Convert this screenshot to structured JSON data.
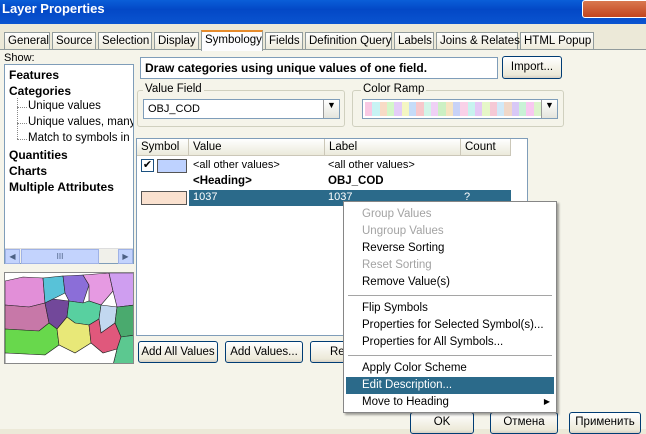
{
  "window": {
    "title": "Layer Properties"
  },
  "tabs": [
    "General",
    "Source",
    "Selection",
    "Display",
    "Symbology",
    "Fields",
    "Definition Query",
    "Labels",
    "Joins & Relates",
    "HTML Popup"
  ],
  "active_tab": "Symbology",
  "show_panel": {
    "label": "Show:",
    "items": [
      {
        "label": "Features",
        "level": 0
      },
      {
        "label": "Categories",
        "level": 0
      },
      {
        "label": "Unique values",
        "level": 1
      },
      {
        "label": "Unique values, many fields",
        "level": 1
      },
      {
        "label": "Match to symbols in a style",
        "level": 1
      },
      {
        "label": "Quantities",
        "level": 0
      },
      {
        "label": "Charts",
        "level": 0
      },
      {
        "label": "Multiple Attributes",
        "level": 0
      }
    ],
    "scroll_grip": "III"
  },
  "description": "Draw categories using unique values of one field.",
  "import_label": "Import...",
  "value_field": {
    "label": "Value Field",
    "value": "OBJ_COD"
  },
  "color_ramp": {
    "label": "Color Ramp",
    "colors": [
      "#f9c9e3",
      "#c7f3f4",
      "#f8dbc6",
      "#d4f7c9",
      "#e4cdf8",
      "#f4f6c3",
      "#c5dcf8",
      "#f7c8cb",
      "#d2f5e8",
      "#efd0f5",
      "#ccf0c4",
      "#f6e4c2",
      "#c8d2f7",
      "#f9d1e8",
      "#c8f3ef",
      "#e5c9f5",
      "#e6f7c8",
      "#f5c9d6",
      "#d1e9f8",
      "#f0d8c9",
      "#d8c8f6",
      "#c9f2d6",
      "#f8c8f0",
      "#dcf4cb"
    ]
  },
  "table": {
    "columns": [
      "Symbol",
      "Value",
      "Label",
      "Count"
    ],
    "rows": [
      {
        "checked": true,
        "symbol_color": "#bed2ff",
        "value": "<all other values>",
        "label": "<all other values>",
        "count": "",
        "bold": false
      },
      {
        "checked": false,
        "symbol_color": "",
        "value": "<Heading>",
        "label": "OBJ_COD",
        "count": "",
        "bold": true
      },
      {
        "checked": false,
        "symbol_color": "#fae1cf",
        "value": "1037",
        "label": "1037",
        "count": "?",
        "bold": false,
        "selected": true
      }
    ]
  },
  "buttons": {
    "add_all": "Add All Values",
    "add_values": "Add Values...",
    "remove_partial": "Re"
  },
  "context_menu": [
    {
      "label": "Group Values",
      "enabled": false
    },
    {
      "label": "Ungroup Values",
      "enabled": false
    },
    {
      "label": "Reverse Sorting",
      "enabled": true
    },
    {
      "label": "Reset Sorting",
      "enabled": false
    },
    {
      "label": "Remove Value(s)",
      "enabled": true
    },
    {
      "separator": true
    },
    {
      "label": "Flip Symbols",
      "enabled": true
    },
    {
      "label": "Properties for Selected Symbol(s)...",
      "enabled": true
    },
    {
      "label": "Properties for All Symbols...",
      "enabled": true
    },
    {
      "separator": true
    },
    {
      "label": "Apply Color Scheme",
      "enabled": true
    },
    {
      "label": "Edit Description...",
      "enabled": true,
      "highlighted": true
    },
    {
      "label": "Move to Heading",
      "enabled": true,
      "submenu": true
    }
  ],
  "footer": {
    "ok": "OK",
    "cancel": "Отмена",
    "apply": "Применить"
  },
  "colors": {
    "selection": "#2b6a8a",
    "title_bar": "#0348c6"
  }
}
